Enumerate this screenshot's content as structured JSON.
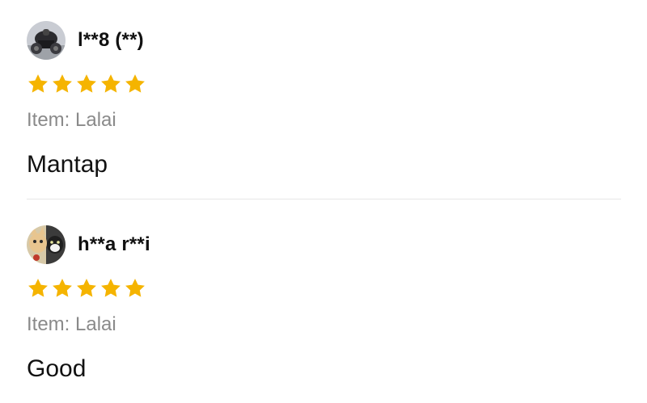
{
  "reviews": [
    {
      "username": "l**8 (**)",
      "avatar_icon": "motorcycle-photo-avatar",
      "rating": 5,
      "variant": "Item: Lalai",
      "comment": "Mantap"
    },
    {
      "username": "h**a r**i",
      "avatar_icon": "cats-photo-avatar",
      "rating": 5,
      "variant": "Item: Lalai",
      "comment": "Good"
    }
  ],
  "colors": {
    "star": "#F5B400",
    "muted_text": "#8A8A8A",
    "divider": "#E6E6E6"
  }
}
